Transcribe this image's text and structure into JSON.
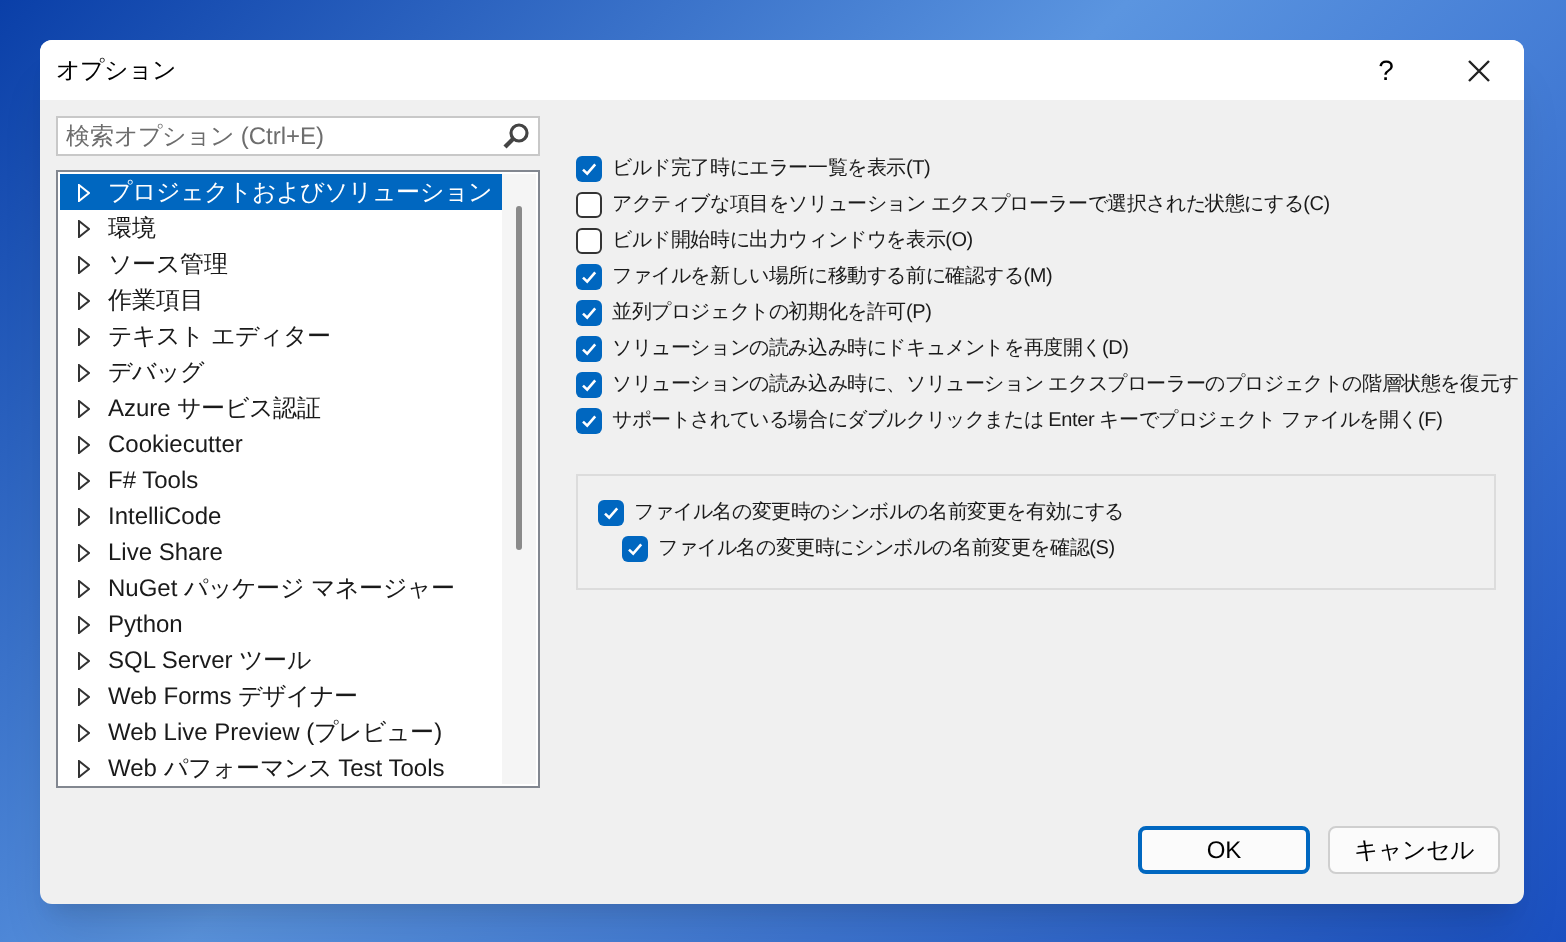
{
  "window": {
    "title": "オプション",
    "help": "?"
  },
  "search": {
    "placeholder": "検索オプション (Ctrl+E)"
  },
  "tree": [
    {
      "label": "プロジェクトおよびソリューション",
      "selected": true
    },
    {
      "label": "環境",
      "selected": false
    },
    {
      "label": "ソース管理",
      "selected": false
    },
    {
      "label": "作業項目",
      "selected": false
    },
    {
      "label": "テキスト エディター",
      "selected": false
    },
    {
      "label": "デバッグ",
      "selected": false
    },
    {
      "label": "Azure サービス認証",
      "selected": false
    },
    {
      "label": "Cookiecutter",
      "selected": false
    },
    {
      "label": "F# Tools",
      "selected": false
    },
    {
      "label": "IntelliCode",
      "selected": false
    },
    {
      "label": "Live Share",
      "selected": false
    },
    {
      "label": "NuGet パッケージ マネージャー",
      "selected": false
    },
    {
      "label": "Python",
      "selected": false
    },
    {
      "label": "SQL Server ツール",
      "selected": false
    },
    {
      "label": "Web Forms デザイナー",
      "selected": false
    },
    {
      "label": "Web Live Preview (プレビュー)",
      "selected": false
    },
    {
      "label": "Web パフォーマンス Test Tools",
      "selected": false
    }
  ],
  "options": [
    {
      "label": "ビルド完了時にエラー一覧を表示(T)",
      "checked": true
    },
    {
      "label": "アクティブな項目をソリューション エクスプローラーで選択された状態にする(C)",
      "checked": false
    },
    {
      "label": "ビルド開始時に出力ウィンドウを表示(O)",
      "checked": false
    },
    {
      "label": "ファイルを新しい場所に移動する前に確認する(M)",
      "checked": true
    },
    {
      "label": "並列プロジェクトの初期化を許可(P)",
      "checked": true
    },
    {
      "label": "ソリューションの読み込み時にドキュメントを再度開く(D)",
      "checked": true
    },
    {
      "label": "ソリューションの読み込み時に、ソリューション エクスプローラーのプロジェクトの階層状態を復元す",
      "checked": true
    },
    {
      "label": "サポートされている場合にダブルクリックまたは Enter キーでプロジェクト ファイルを開く(F)",
      "checked": true
    }
  ],
  "rename_group": [
    {
      "label": "ファイル名の変更時のシンボルの名前変更を有効にする",
      "checked": true
    },
    {
      "label": "ファイル名の変更時にシンボルの名前変更を確認(S)",
      "checked": true
    }
  ],
  "buttons": [
    {
      "label": "OK",
      "kind": "primary"
    },
    {
      "label": "キャンセル",
      "kind": "secondary"
    }
  ]
}
